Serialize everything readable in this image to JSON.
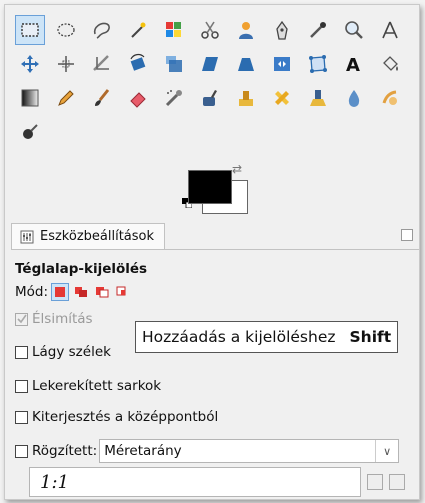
{
  "colors": {
    "foreground": "#000000",
    "background": "#ffffff",
    "active_highlight": "#cde4f7",
    "active_border": "#6aa0d8",
    "tooltip_bg": "#ffffff"
  },
  "toolbox": {
    "rows": [
      [
        "rect-select-icon",
        "ellipse-select-icon",
        "free-select-icon",
        "fuzzy-select-icon",
        "select-by-color-icon",
        "scissors-select-icon",
        "foreground-select-icon",
        "paths-icon",
        "color-picker-icon",
        "zoom-icon",
        "measure-icon"
      ],
      [
        "move-icon",
        "align-icon",
        "crop-icon",
        "rotate-icon",
        "scale-icon",
        "shear-icon",
        "perspective-icon",
        "flip-icon",
        "cage-transform-icon",
        "text-icon",
        "bucket-fill-icon"
      ],
      [
        "blend-icon",
        "pencil-icon",
        "paintbrush-icon",
        "eraser-icon",
        "airbrush-icon",
        "ink-icon",
        "clone-icon",
        "heal-icon",
        "perspective-clone-icon",
        "blur-sharpen-icon",
        "smudge-icon"
      ],
      [
        "dodge-burn-icon"
      ]
    ],
    "active_tool": "rect-select-icon"
  },
  "dock": {
    "tab_label": "Eszközbeállítások"
  },
  "options": {
    "tool_title": "Téglalap-kijelölés",
    "mode_label": "Mód:",
    "antialias_label": "Élsimítás",
    "feather_label": "Lágy szélek",
    "rounded_label": "Lekerekített sarkok",
    "expand_label": "Kiterjesztés a középpontból",
    "fixed_label": "Rögzített:",
    "fixed_select_value": "Méretarány",
    "ratio_value": "1:1"
  },
  "tooltip": {
    "text": "Hozzáadás a kijelöléshez",
    "shortcut": "Shift"
  }
}
